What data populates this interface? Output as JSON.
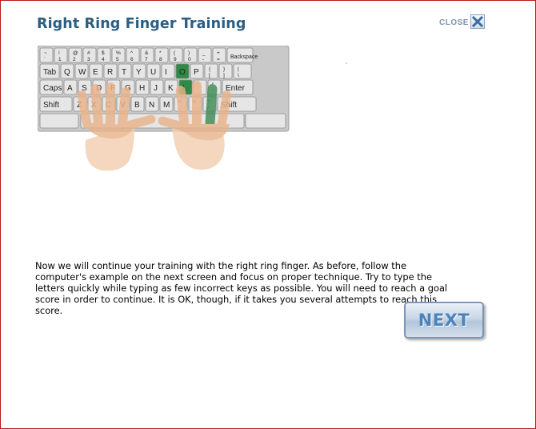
{
  "header": {
    "title": "Right Ring Finger Training",
    "close_label": "CLOSE"
  },
  "keyboard": {
    "rows": [
      [
        {
          "top": "~",
          "bottom": "`"
        },
        {
          "top": "!",
          "bottom": "1"
        },
        {
          "top": "@",
          "bottom": "2"
        },
        {
          "top": "#",
          "bottom": "3"
        },
        {
          "top": "$",
          "bottom": "4"
        },
        {
          "top": "%",
          "bottom": "5"
        },
        {
          "top": "^",
          "bottom": "6"
        },
        {
          "top": "&",
          "bottom": "7"
        },
        {
          "top": "*",
          "bottom": "8"
        },
        {
          "top": "(",
          "bottom": "9"
        },
        {
          "top": ")",
          "bottom": "0"
        },
        {
          "top": "_",
          "bottom": "-"
        },
        {
          "top": "+",
          "bottom": "="
        },
        {
          "label": "Backspace"
        }
      ],
      [
        {
          "label": "Tab"
        },
        {
          "label": "Q"
        },
        {
          "label": "W"
        },
        {
          "label": "E"
        },
        {
          "label": "R"
        },
        {
          "label": "T"
        },
        {
          "label": "Y"
        },
        {
          "label": "U"
        },
        {
          "label": "I"
        },
        {
          "label": "O",
          "highlight": true
        },
        {
          "label": "P"
        },
        {
          "top": "{",
          "bottom": "["
        },
        {
          "top": "}",
          "bottom": "]"
        },
        {
          "top": "|",
          "bottom": "\\"
        }
      ],
      [
        {
          "label": "Caps"
        },
        {
          "label": "A"
        },
        {
          "label": "S"
        },
        {
          "label": "D"
        },
        {
          "label": "F"
        },
        {
          "label": "G"
        },
        {
          "label": "H"
        },
        {
          "label": "J"
        },
        {
          "label": "K"
        },
        {
          "label": "L",
          "highlight": true
        },
        {
          "top": ":",
          "bottom": ";"
        },
        {
          "top": "\"",
          "bottom": "'"
        },
        {
          "label": "Enter"
        }
      ],
      [
        {
          "label": "Shift"
        },
        {
          "label": "Z"
        },
        {
          "label": "X"
        },
        {
          "label": "C"
        },
        {
          "label": "V"
        },
        {
          "label": "B"
        },
        {
          "label": "N"
        },
        {
          "label": "M"
        },
        {
          "top": "<",
          "bottom": ","
        },
        {
          "top": ">",
          "bottom": "."
        },
        {
          "top": "?",
          "bottom": "/"
        },
        {
          "label": "Shift"
        }
      ]
    ],
    "highlight_color": "#2f8a45",
    "key_color": "#e6e6e6"
  },
  "main": {
    "instructions": "Now we will continue your training with the right ring finger. As before, follow the computer's example on the next screen and focus on proper technique. Try to type the letters quickly while typing as few incorrect keys as possible. You will need to reach a goal score in order to continue. It is OK, though, if it takes you several attempts to reach this score."
  },
  "footer": {
    "next_label": "NEXT"
  },
  "icons": {
    "close": "close-x-icon",
    "hands": "hands-illustration"
  },
  "colors": {
    "title": "#2a5e82",
    "border": "#b71c1c",
    "next_text": "#4c83ba"
  }
}
